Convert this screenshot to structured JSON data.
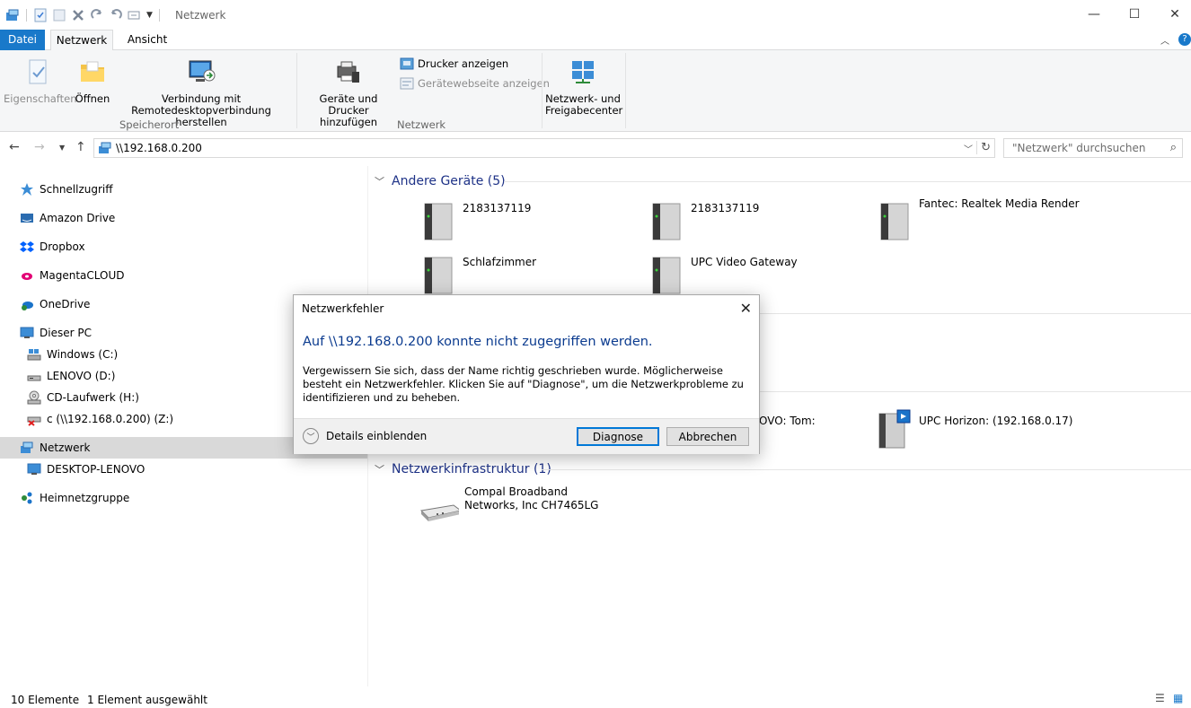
{
  "window": {
    "title": "Netzwerk",
    "minimize_glyph": "—",
    "maximize_glyph": "☐",
    "close_glyph": "✕"
  },
  "ribbon_tabs": [
    "Datei",
    "Netzwerk",
    "Ansicht"
  ],
  "ribbon": {
    "properties": "Eigenschaften",
    "open": "Öffnen",
    "remote_line1": "Verbindung mit",
    "remote_line2": "Remotedesktopverbindung herstellen",
    "group_location": "Speicherort",
    "add_devices_line1": "Geräte und Drucker",
    "add_devices_line2": "hinzufügen",
    "show_printers": "Drucker anzeigen",
    "device_webpage": "Gerätewebseite anzeigen",
    "group_network": "Netzwerk",
    "network_center_line1": "Netzwerk- und",
    "network_center_line2": "Freigabecenter"
  },
  "address": {
    "path": "\\\\192.168.0.200",
    "search_placeholder": "\"Netzwerk\" durchsuchen"
  },
  "sidebar": {
    "items": [
      {
        "label": "Schnellzugriff",
        "icon": "star-icon"
      },
      {
        "label": "Amazon Drive",
        "icon": "amazon-drive-icon"
      },
      {
        "label": "Dropbox",
        "icon": "dropbox-icon"
      },
      {
        "label": "MagentaCLOUD",
        "icon": "magentacloud-icon"
      },
      {
        "label": "OneDrive",
        "icon": "onedrive-icon"
      },
      {
        "label": "Dieser PC",
        "icon": "pc-icon"
      },
      {
        "label": "Windows (C:)",
        "icon": "windows-drive-icon"
      },
      {
        "label": "LENOVO (D:)",
        "icon": "drive-icon"
      },
      {
        "label": "CD-Laufwerk (H:)",
        "icon": "cd-drive-icon"
      },
      {
        "label": "c (\\\\192.168.0.200) (Z:)",
        "icon": "network-drive-disconnected-icon"
      },
      {
        "label": "Netzwerk",
        "icon": "network-icon"
      },
      {
        "label": "DESKTOP-LENOVO",
        "icon": "computer-icon"
      },
      {
        "label": "Heimnetzgruppe",
        "icon": "homegroup-icon"
      }
    ]
  },
  "content": {
    "group_other": "Andere Geräte (5)",
    "other_devices": [
      {
        "name": "2183137119"
      },
      {
        "name": "2183137119"
      },
      {
        "name": "Fantec: Realtek Media Render"
      },
      {
        "name": "Schlafzimmer"
      },
      {
        "name": "UPC Video Gateway"
      }
    ],
    "media_partial": "OVO: Tom:",
    "media_upc": "UPC Horizon: (192.168.0.17)",
    "group_infra": "Netzwerkinfrastruktur (1)",
    "router_line1": "Compal Broadband",
    "router_line2": "Networks, Inc CH7465LG"
  },
  "dialog": {
    "title": "Netzwerkfehler",
    "heading": "Auf \\\\192.168.0.200 konnte nicht zugegriffen werden.",
    "body": "Vergewissern Sie sich, dass der Name richtig geschrieben wurde. Möglicherweise besteht ein Netzwerkfehler. Klicken Sie auf \"Diagnose\", um die Netzwerkprobleme zu identifizieren und zu beheben.",
    "details": "Details einblenden",
    "diagnose": "Diagnose",
    "cancel": "Abbrechen"
  },
  "status": {
    "count": "10 Elemente",
    "selected": "1 Element ausgewählt"
  },
  "colors": {
    "accent": "#1979ca",
    "heading_blue": "#1e3287",
    "dialog_heading": "#0b3b8f"
  }
}
